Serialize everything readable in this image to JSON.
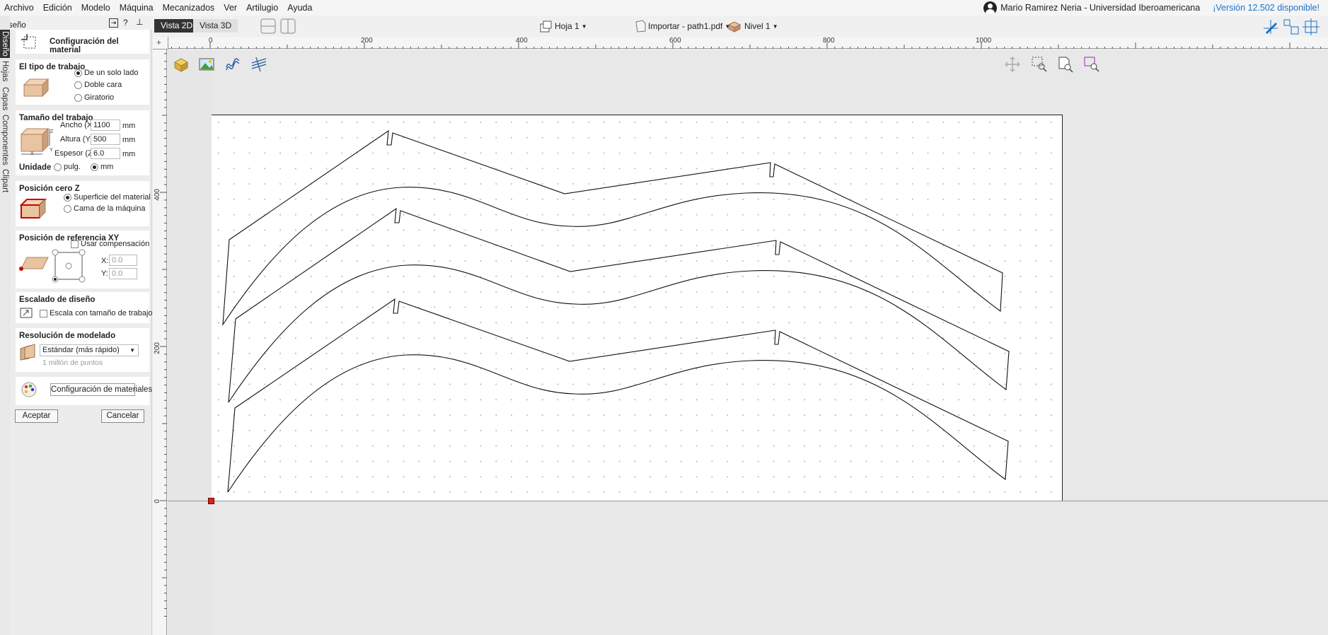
{
  "menu": [
    "Archivo",
    "Edición",
    "Modelo",
    "Máquina",
    "Mecanizados",
    "Ver",
    "Artilugio",
    "Ayuda"
  ],
  "user": {
    "name": "Mario Ramirez Neria  - Universidad Iberoamericana",
    "version": "¡Versión 12.502 disponible!"
  },
  "left_tabs": [
    "Diseño",
    "Hojas",
    "Capas",
    "Componentes",
    "Clipart"
  ],
  "panel": {
    "header": "Diseño",
    "title": "Configuración del material",
    "job_type": {
      "title": "El tipo de trabajo",
      "options": [
        "De un solo lado",
        "Doble cara",
        "Giratorio"
      ],
      "selected": 0
    },
    "job_size": {
      "title": "Tamaño del trabajo",
      "width_label": "Ancho (X):",
      "width": "1100",
      "height_label": "Altura (Y):",
      "height": "500",
      "thickness_label": "Espesor (Z):",
      "thickness": "6.0",
      "unit": "mm",
      "units_label": "Unidade",
      "unit_options": [
        "pulg.",
        "mm"
      ],
      "selected_unit": 1
    },
    "z_zero": {
      "title": "Posición cero Z",
      "options": [
        "Superficie del material",
        "Cama de la máquina"
      ],
      "selected": 0
    },
    "xy_ref": {
      "title": "Posición de referencia XY",
      "offset_label": "Usar compensación",
      "x_label": "X:",
      "x": "0.0",
      "y_label": "Y:",
      "y": "0.0"
    },
    "scaling": {
      "title": "Escalado de diseño",
      "option": "Escala con tamaño de trabajo."
    },
    "resolution": {
      "title": "Resolución de modelado",
      "value": "Estándar (más rápido)",
      "hint": "1 millón de puntos"
    },
    "materials_button": "Configuración de materiales",
    "accept": "Aceptar",
    "cancel": "Cancelar"
  },
  "toolbar": {
    "view2d": "Vista 2D",
    "view3d": "Vista 3D",
    "sheet": "Hoja 1",
    "import": "Importar - path1.pdf",
    "level": "Nivel 1"
  },
  "ruler_top": [
    "0",
    "200",
    "400",
    "600",
    "800",
    "1000"
  ],
  "ruler_left": [
    "400",
    "200",
    "0"
  ]
}
